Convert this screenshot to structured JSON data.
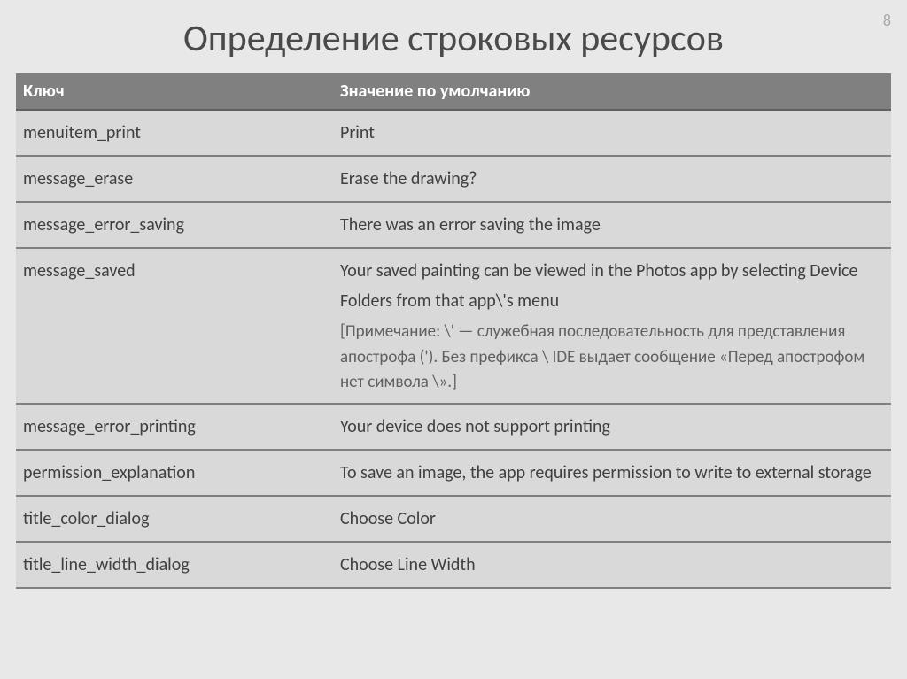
{
  "page_number": "8",
  "title": "Определение строковых ресурсов",
  "headers": {
    "key": "Ключ",
    "value": "Значение по умолчанию"
  },
  "rows": [
    {
      "key": "menuitem_print",
      "value": "Print"
    },
    {
      "key": "message_erase",
      "value": "Erase the drawing?"
    },
    {
      "key": "message_error_saving",
      "value": "There was an error saving the image"
    },
    {
      "key": "message_saved",
      "value": "Your saved painting can be viewed in the Photos app by selecting Device Folders from that app\\'s menu",
      "note": "[Примечание: \\' — служебная последовательность для представления апострофа ('). Без префикса \\ IDE выдает сообщение «Перед апострофом нет символа \\».]"
    },
    {
      "key": "message_error_printing",
      "value": "Your device does not support printing"
    },
    {
      "key": "permission_explanation",
      "value": "To save an image, the app requires permission to write to external storage"
    },
    {
      "key": "title_color_dialog",
      "value": "Choose Color"
    },
    {
      "key": "title_line_width_dialog",
      "value": "Choose Line Width"
    }
  ]
}
